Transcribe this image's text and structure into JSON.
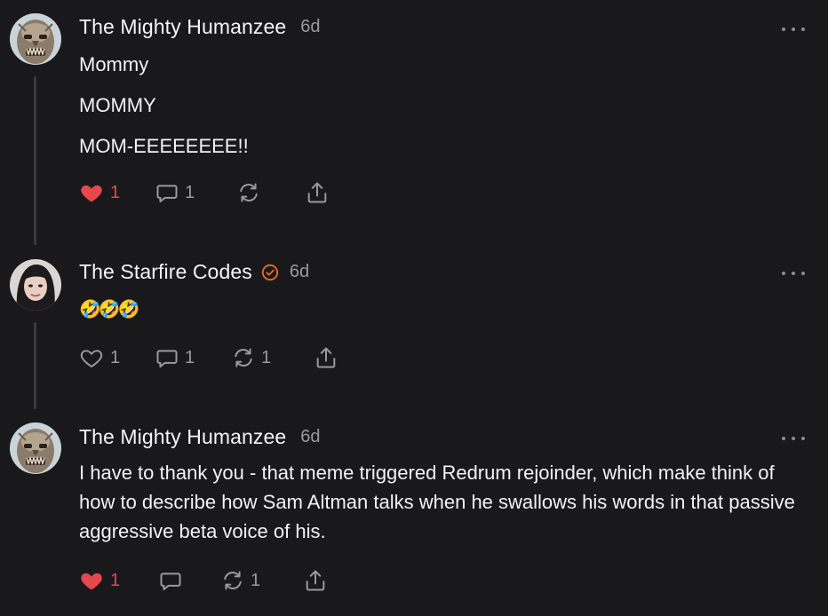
{
  "comments": [
    {
      "author": "The Mighty Humanzee",
      "time": "6d",
      "paragraphs": [
        "Mommy",
        "MOMMY",
        "MOM-EEEEEEEE!!"
      ],
      "likes": "1",
      "replies": "1",
      "restacks": "",
      "liked": true,
      "avatar_icon": "gargoyle-face-avatar"
    },
    {
      "author": "The Starfire Codes",
      "time": "6d",
      "paragraphs": [
        "🤣🤣🤣"
      ],
      "likes": "1",
      "replies": "1",
      "restacks": "1",
      "liked": false,
      "verified": true,
      "avatar_icon": "woman-portrait-avatar"
    },
    {
      "author": "The Mighty Humanzee",
      "time": "6d",
      "paragraphs": [
        "I have to thank you - that meme triggered Redrum rejoinder, which make think of how to describe how Sam Altman talks when he swallows his words in that passive aggressive beta voice of his."
      ],
      "likes": "1",
      "replies": "",
      "restacks": "1",
      "liked": true,
      "avatar_icon": "gargoyle-face-avatar"
    }
  ],
  "colors": {
    "background": "#19191b",
    "like_red": "#e5484d",
    "muted": "#9a9a9e",
    "verified_orange": "#f06a2b"
  }
}
